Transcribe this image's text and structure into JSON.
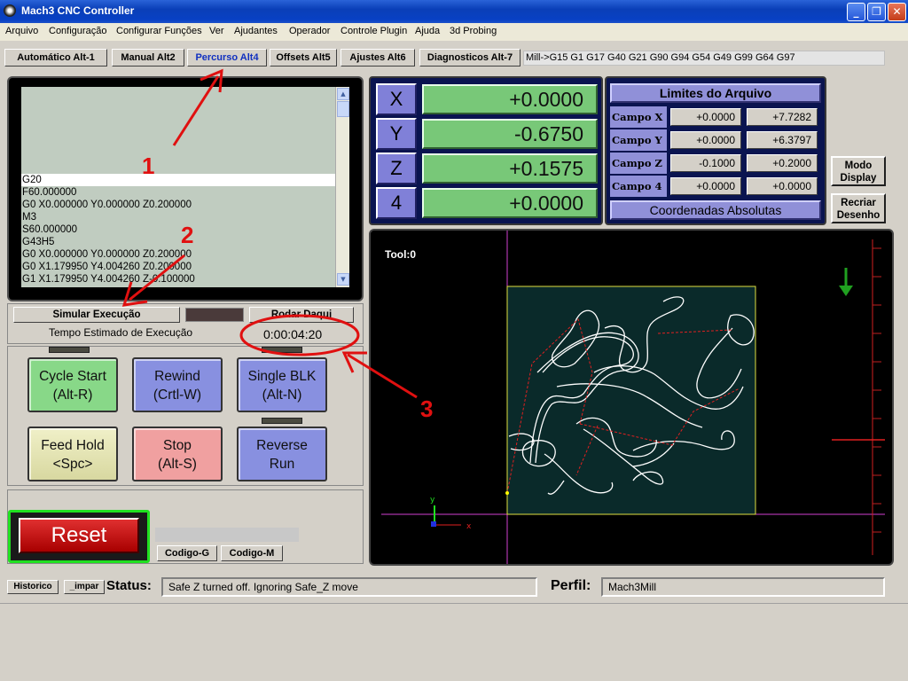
{
  "window": {
    "title": "Mach3 CNC Controller"
  },
  "menu": [
    "Arquivo",
    "Configuração",
    "Configurar Funções",
    "Ver",
    "Ajudantes",
    "Operador",
    "Controle Plugin",
    "Ajuda",
    "3d Probing"
  ],
  "tabs": [
    "Automático Alt-1",
    "Manual Alt2",
    "Percurso Alt4",
    "Offsets Alt5",
    "Ajustes Alt6",
    "Diagnosticos Alt-7"
  ],
  "active_tab": "Percurso Alt4",
  "modal_line": "Mill->G15  G1 G17 G40 G21 G90 G94 G54 G49 G99 G64 G97",
  "gcode_lines": [
    "G20",
    "F60.000000",
    "G0 X0.000000 Y0.000000 Z0.200000",
    "M3",
    "S60.000000",
    "G43H5",
    "G0 X0.000000 Y0.000000 Z0.200000",
    "G0 X1.179950 Y4.004260 Z0.200000",
    "G1 X1.179950 Y4.004260 Z-0.100000"
  ],
  "simulate": {
    "button": "Simular Execução",
    "run_from": "Rodar Daqui",
    "estimated_label": "Tempo Estimado de Execução",
    "time": "0:00:04:20"
  },
  "controls": {
    "cycle_start": "Cycle Start",
    "cycle_start_key": "(Alt-R)",
    "rewind": "Rewind",
    "rewind_key": "(Crtl-W)",
    "single_blk": "Single BLK",
    "single_blk_key": "(Alt-N)",
    "feed_hold": "Feed Hold",
    "feed_hold_key": "<Spc>",
    "stop": "Stop",
    "stop_key": "(Alt-S)",
    "reverse": "Reverse",
    "reverse_key": "Run"
  },
  "reset": "Reset",
  "code_buttons": [
    "Codigo-G",
    "Codigo-M"
  ],
  "dro": [
    {
      "axis": "X",
      "value": "+0.0000"
    },
    {
      "axis": "Y",
      "value": "-0.6750"
    },
    {
      "axis": "Z",
      "value": "+0.1575"
    },
    {
      "axis": "4",
      "value": "+0.0000"
    }
  ],
  "limits": {
    "title": "Limites do Arquivo",
    "rows": [
      {
        "label": "Campo X",
        "min": "+0.0000",
        "max": "+7.7282"
      },
      {
        "label": "Campo Y",
        "min": "+0.0000",
        "max": "+6.3797"
      },
      {
        "label": "Campo Z",
        "min": "-0.1000",
        "max": "+0.2000"
      },
      {
        "label": "Campo 4",
        "min": "+0.0000",
        "max": "+0.0000"
      }
    ],
    "footer": "Coordenadas Absolutas"
  },
  "side_buttons": {
    "display_mode_1": "Modo",
    "display_mode_2": "Display",
    "regen_1": "Recriar",
    "regen_2": "Desenho"
  },
  "toolpath": {
    "tool_label": "Tool:0"
  },
  "status": {
    "history": "Historico",
    "clear": "_impar",
    "label": "Status:",
    "message": "Safe Z turned off. Ignoring Safe_Z move",
    "profile_label": "Perfil:",
    "profile": "Mach3Mill"
  },
  "annotations": [
    "1",
    "2",
    "3"
  ],
  "colors": {
    "dro_green": "#78c878",
    "axis_blue": "#8080d8",
    "annotation_red": "#e01010"
  }
}
